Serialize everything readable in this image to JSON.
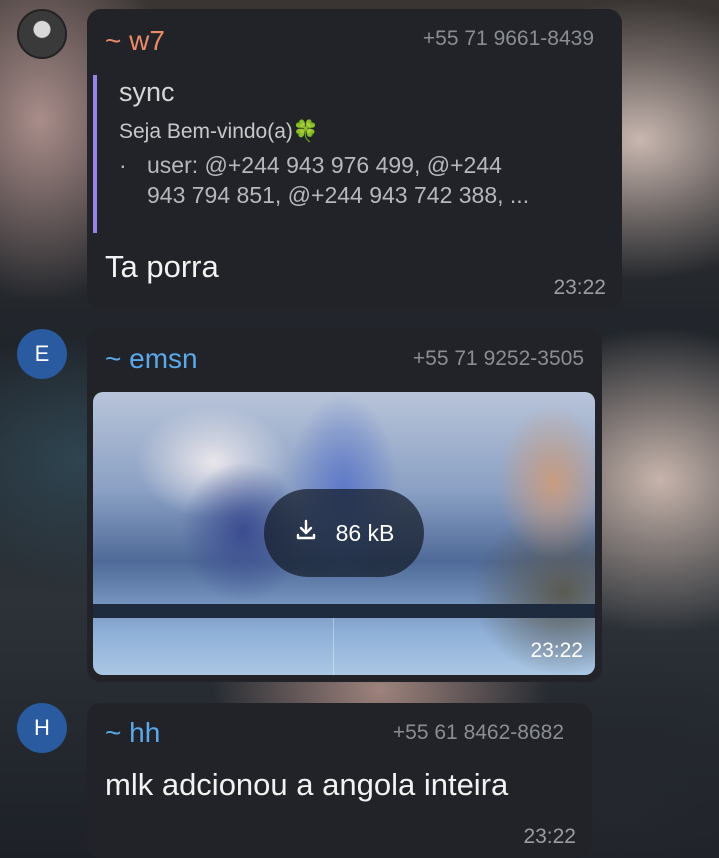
{
  "messages": [
    {
      "sender": "~ w7",
      "sender_color": "#e98a68",
      "phone": "+55 71 9661-8439",
      "reply": {
        "title": "sync",
        "subtitle": "Seja Bem-vindo(a)🍀",
        "bullet": "·",
        "text_line1": "user: @+244 943 976 499, @+244",
        "text_line2": "943 794 851, @+244 943 742 388, ..."
      },
      "text": "Ta porra",
      "time": "23:22"
    },
    {
      "avatar_letter": "E",
      "sender": "~ emsn",
      "sender_color": "#5aa9ea",
      "phone": "+55 71 9252-3505",
      "media": {
        "size": "86 kB",
        "icon": "download-icon"
      },
      "time": "23:22"
    },
    {
      "avatar_letter": "H",
      "sender": "~ hh",
      "sender_color": "#5aa9ea",
      "phone": "+55 61 8462-8682",
      "text": "mlk adcionou a angola inteira",
      "time": "23:22"
    }
  ]
}
